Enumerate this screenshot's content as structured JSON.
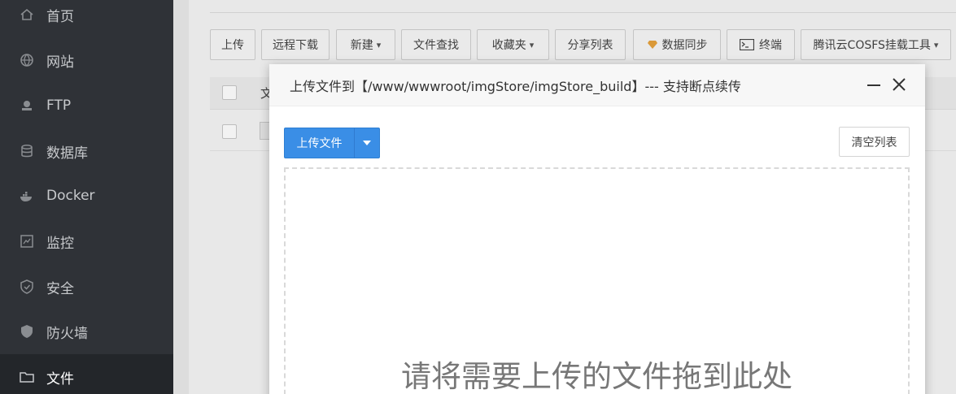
{
  "sidebar": {
    "items": [
      {
        "label": "首页",
        "icon": "home-icon"
      },
      {
        "label": "网站",
        "icon": "globe-icon"
      },
      {
        "label": "FTP",
        "icon": "ftp-icon"
      },
      {
        "label": "数据库",
        "icon": "database-icon"
      },
      {
        "label": "Docker",
        "icon": "docker-icon"
      },
      {
        "label": "监控",
        "icon": "monitor-icon"
      },
      {
        "label": "安全",
        "icon": "shield-check-icon"
      },
      {
        "label": "防火墙",
        "icon": "firewall-icon"
      },
      {
        "label": "文件",
        "icon": "folder-icon",
        "active": true
      }
    ]
  },
  "toolbar": {
    "upload": "上传",
    "remote_download": "远程下载",
    "new": "新建",
    "file_search": "文件查找",
    "favorites": "收藏夹",
    "share_list": "分享列表",
    "data_sync": "数据同步",
    "terminal": "终端",
    "cosfs_tool": "腾讯云COSFS挂载工具"
  },
  "table": {
    "header_partial": "文"
  },
  "modal": {
    "title": "上传文件到【/www/wwwroot/imgStore/imgStore_build】--- 支持断点续传",
    "upload_button": "上传文件",
    "clear_button": "清空列表",
    "drop_hint": "请将需要上传的文件拖到此处"
  },
  "colors": {
    "sidebar_bg": "#2f3237",
    "primary_blue": "#3a8ee6",
    "data_sync_icon": "#e6a23c"
  }
}
